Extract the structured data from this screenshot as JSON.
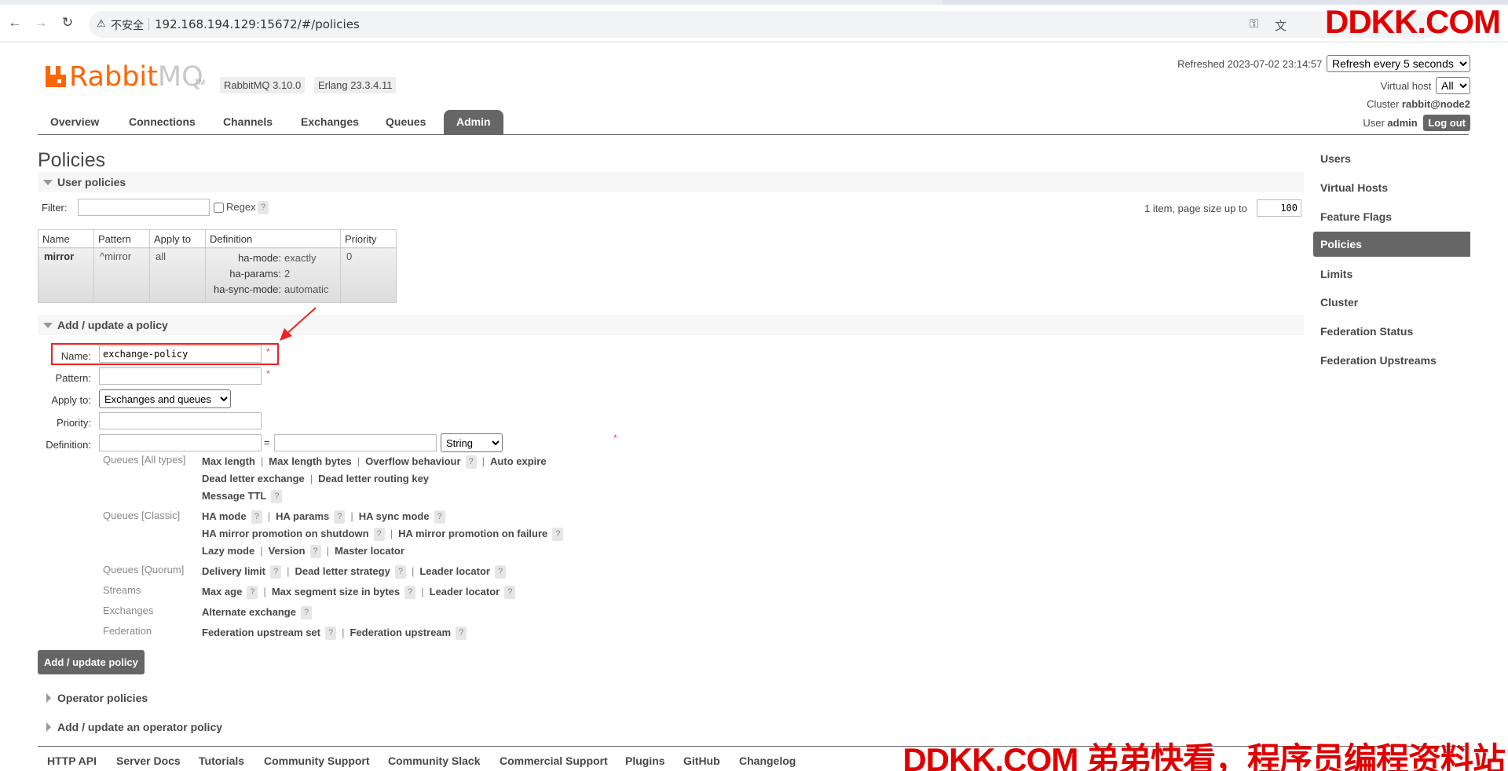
{
  "browser": {
    "insecure_label": "不安全",
    "url": "192.168.194.129:15672/#/policies",
    "watermark_top": "DDKK.COM"
  },
  "header": {
    "logo_text_orange": "Rabbit",
    "logo_text_grey": "MQ",
    "logo_tm": "TM",
    "rabbitmq_version": "RabbitMQ 3.10.0",
    "erlang_version": "Erlang 23.3.4.11",
    "refreshed_label": "Refreshed 2023-07-02 23:14:57",
    "refresh_select": "Refresh every 5 seconds",
    "virtual_host_label": "Virtual host",
    "virtual_host_value": "All",
    "cluster_label": "Cluster",
    "cluster_value": "rabbit@node2",
    "user_label": "User",
    "user_value": "admin",
    "logout_label": "Log out"
  },
  "tabs": [
    {
      "label": "Overview"
    },
    {
      "label": "Connections"
    },
    {
      "label": "Channels"
    },
    {
      "label": "Exchanges"
    },
    {
      "label": "Queues"
    },
    {
      "label": "Admin"
    }
  ],
  "page_title": "Policies",
  "user_policies": {
    "heading": "User policies",
    "filter_label": "Filter:",
    "regex_label": "Regex",
    "help": "?",
    "paging_label": "1 item, page size up to",
    "page_size": "100",
    "columns": [
      "Name",
      "Pattern",
      "Apply to",
      "Definition",
      "Priority"
    ],
    "rows": [
      {
        "name": "mirror",
        "pattern": "^mirror",
        "apply_to": "all",
        "definition": [
          {
            "key": "ha-mode:",
            "value": "exactly"
          },
          {
            "key": "ha-params:",
            "value": "2"
          },
          {
            "key": "ha-sync-mode:",
            "value": "automatic"
          }
        ],
        "priority": "0"
      }
    ]
  },
  "add_policy": {
    "heading": "Add / update a policy",
    "name_label": "Name:",
    "name_value": "exchange-policy",
    "pattern_label": "Pattern:",
    "pattern_value": "",
    "apply_to_label": "Apply to:",
    "apply_to_value": "Exchanges and queues",
    "priority_label": "Priority:",
    "definition_label": "Definition:",
    "equals": "=",
    "type_value": "String",
    "required_mark": "*",
    "categories": [
      {
        "label": "Queues [All types]"
      },
      {
        "label": "Queues [Classic]"
      },
      {
        "label": "Queues [Quorum]"
      },
      {
        "label": "Streams"
      },
      {
        "label": "Exchanges"
      },
      {
        "label": "Federation"
      }
    ],
    "options": {
      "all_1": [
        "Max length",
        "Max length bytes",
        "Overflow behaviour",
        "Auto expire"
      ],
      "all_2": [
        "Dead letter exchange",
        "Dead letter routing key"
      ],
      "all_3": [
        "Message TTL"
      ],
      "classic_1": [
        "HA mode",
        "HA params",
        "HA sync mode"
      ],
      "classic_2": [
        "HA mirror promotion on shutdown",
        "HA mirror promotion on failure"
      ],
      "classic_3": [
        "Lazy mode",
        "Version",
        "Master locator"
      ],
      "quorum_1": [
        "Delivery limit",
        "Dead letter strategy",
        "Leader locator"
      ],
      "streams_1": [
        "Max age",
        "Max segment size in bytes",
        "Leader locator"
      ],
      "exchanges_1": [
        "Alternate exchange"
      ],
      "federation_1": [
        "Federation upstream set",
        "Federation upstream"
      ]
    },
    "submit_label": "Add / update policy"
  },
  "operator_policies": {
    "heading": "Operator policies"
  },
  "add_operator_policy": {
    "heading": "Add / update an operator policy"
  },
  "right_nav": [
    {
      "label": "Users"
    },
    {
      "label": "Virtual Hosts"
    },
    {
      "label": "Feature Flags"
    },
    {
      "label": "Policies"
    },
    {
      "label": "Limits"
    },
    {
      "label": "Cluster"
    },
    {
      "label": "Federation Status"
    },
    {
      "label": "Federation Upstreams"
    }
  ],
  "footer": [
    {
      "label": "HTTP API"
    },
    {
      "label": "Server Docs"
    },
    {
      "label": "Tutorials"
    },
    {
      "label": "Community Support"
    },
    {
      "label": "Community Slack"
    },
    {
      "label": "Commercial Support"
    },
    {
      "label": "Plugins"
    },
    {
      "label": "GitHub"
    },
    {
      "label": "Changelog"
    }
  ],
  "watermark_bottom": "DDKK.COM 弟弟快看，程序员编程资料站",
  "colors": {
    "brand_orange": "#ff6600",
    "active_tab": "#666666",
    "annotation_red": "#ee2222",
    "watermark_red": "#e00000"
  },
  "icons": {
    "back": "arrow-left-icon",
    "forward": "arrow-right-icon",
    "reload": "reload-icon",
    "warning": "warning-triangle-icon",
    "annotation": "red-arrow-icon"
  }
}
